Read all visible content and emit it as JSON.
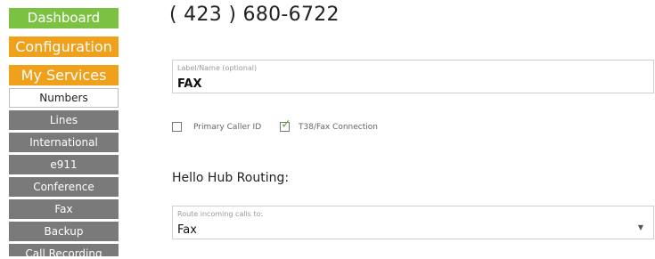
{
  "sidebar": {
    "main": [
      {
        "label": "Dashboard",
        "color": "#7cc242"
      },
      {
        "label": "Configuration",
        "color": "#f0a11c"
      },
      {
        "label": "My Services",
        "color": "#f0a11c"
      }
    ],
    "sub": [
      {
        "label": "Numbers",
        "active": true
      },
      {
        "label": "Lines"
      },
      {
        "label": "International"
      },
      {
        "label": "e911"
      },
      {
        "label": "Conference"
      },
      {
        "label": "Fax"
      },
      {
        "label": "Backup"
      },
      {
        "label": "Call Recording",
        "partially_visible": true
      }
    ]
  },
  "main": {
    "phone_number": "( 423 ) 680-6722",
    "label_field": {
      "label": "Label/Name (optional)",
      "value": "FAX"
    },
    "checkboxes": [
      {
        "label": "Primary Caller ID",
        "checked": false
      },
      {
        "label": "T38/Fax Connection",
        "checked": true
      }
    ],
    "routing_title": "Hello Hub Routing:",
    "route_select": {
      "label": "Route incoming calls to:",
      "value": "Fax"
    }
  }
}
